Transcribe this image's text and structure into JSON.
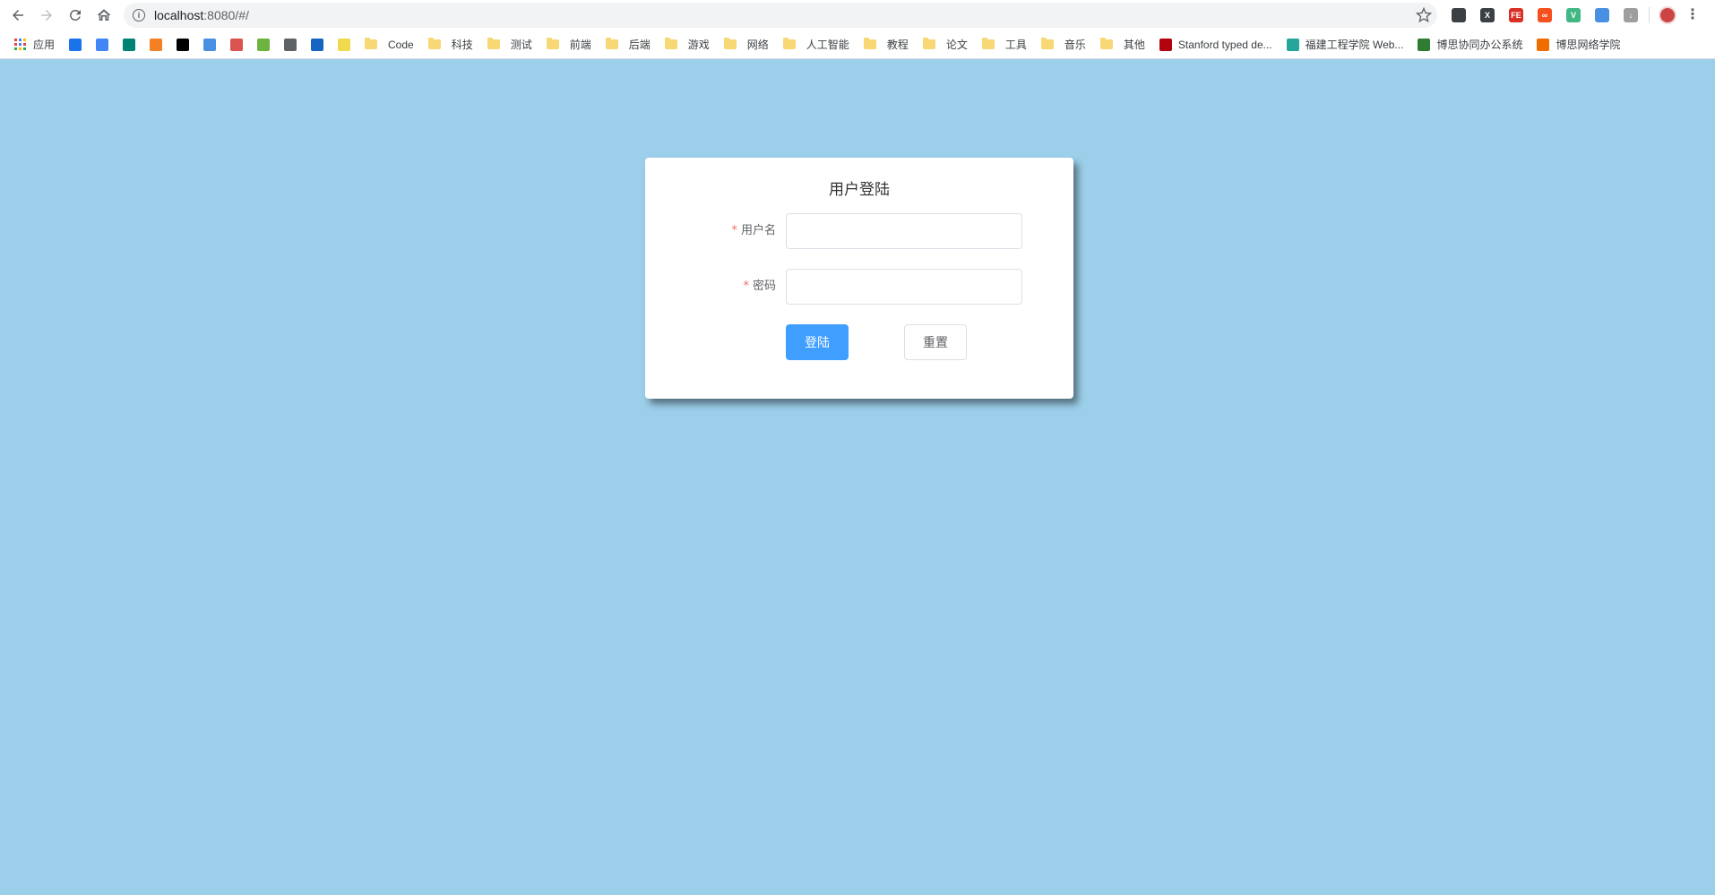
{
  "browser": {
    "url_host": "localhost",
    "url_path": ":8080/#/",
    "bookmarks": [
      {
        "label": "应用",
        "type": "apps"
      },
      {
        "label": "",
        "type": "icon",
        "icon": "puzzle-icon",
        "color": "#1a73e8"
      },
      {
        "label": "",
        "type": "icon",
        "icon": "google-icon",
        "color": "#4285f4"
      },
      {
        "label": "",
        "type": "icon",
        "icon": "bing-icon",
        "color": "#008373"
      },
      {
        "label": "",
        "type": "icon",
        "icon": "stackoverflow-icon",
        "color": "#f48024"
      },
      {
        "label": "",
        "type": "icon",
        "icon": "wikipedia-icon",
        "color": "#000000"
      },
      {
        "label": "",
        "type": "icon",
        "icon": "mortarboard-icon",
        "color": "#4a90e2"
      },
      {
        "label": "",
        "type": "icon",
        "icon": "runner-icon",
        "color": "#d9534f"
      },
      {
        "label": "",
        "type": "icon",
        "icon": "spring-icon",
        "color": "#6db33f"
      },
      {
        "label": "",
        "type": "icon",
        "icon": "folder-outline-icon",
        "color": "#5f6368"
      },
      {
        "label": "",
        "type": "icon",
        "icon": "on-icon",
        "color": "#1565c0"
      },
      {
        "label": "",
        "type": "icon",
        "icon": "es-icon",
        "color": "#f0db4f"
      },
      {
        "label": "Code",
        "type": "folder"
      },
      {
        "label": "科技",
        "type": "folder"
      },
      {
        "label": "测试",
        "type": "folder"
      },
      {
        "label": "前端",
        "type": "folder"
      },
      {
        "label": "后端",
        "type": "folder"
      },
      {
        "label": "游戏",
        "type": "folder"
      },
      {
        "label": "网络",
        "type": "folder"
      },
      {
        "label": "人工智能",
        "type": "folder"
      },
      {
        "label": "教程",
        "type": "folder"
      },
      {
        "label": "论文",
        "type": "folder"
      },
      {
        "label": "工具",
        "type": "folder"
      },
      {
        "label": "音乐",
        "type": "folder"
      },
      {
        "label": "其他",
        "type": "folder"
      },
      {
        "label": "Stanford typed de...",
        "type": "link",
        "icon": "stanford-icon",
        "color": "#b1040e"
      },
      {
        "label": "福建工程学院 Web...",
        "type": "link",
        "icon": "lock-icon",
        "color": "#26a69a"
      },
      {
        "label": "博思协同办公系统",
        "type": "link",
        "icon": "gear-icon",
        "color": "#2e7d32"
      },
      {
        "label": "博思网络学院",
        "type": "link",
        "icon": "swirl-icon",
        "color": "#ef6c00"
      }
    ],
    "extensions": [
      {
        "icon": "ext-cloud-icon",
        "color": "#3c4043",
        "text": ""
      },
      {
        "icon": "ext-x-icon",
        "color": "#3c4043",
        "text": "X"
      },
      {
        "icon": "ext-fe-icon",
        "color": "#d93025",
        "text": "FE"
      },
      {
        "icon": "ext-cc-icon",
        "color": "#f4511e",
        "text": "∞"
      },
      {
        "icon": "ext-vue-icon",
        "color": "#41b883",
        "text": "V"
      },
      {
        "icon": "ext-cap-icon",
        "color": "#4a90e2",
        "text": ""
      },
      {
        "icon": "ext-download-icon",
        "color": "#9e9e9e",
        "text": "↓"
      }
    ]
  },
  "login": {
    "title": "用户登陆",
    "username_label": "用户名",
    "password_label": "密码",
    "required_mark": "*",
    "username_value": "",
    "password_value": "",
    "submit_label": "登陆",
    "reset_label": "重置"
  },
  "colors": {
    "background": "#9ccfea",
    "primary": "#409eff",
    "required": "#f56c6c"
  }
}
